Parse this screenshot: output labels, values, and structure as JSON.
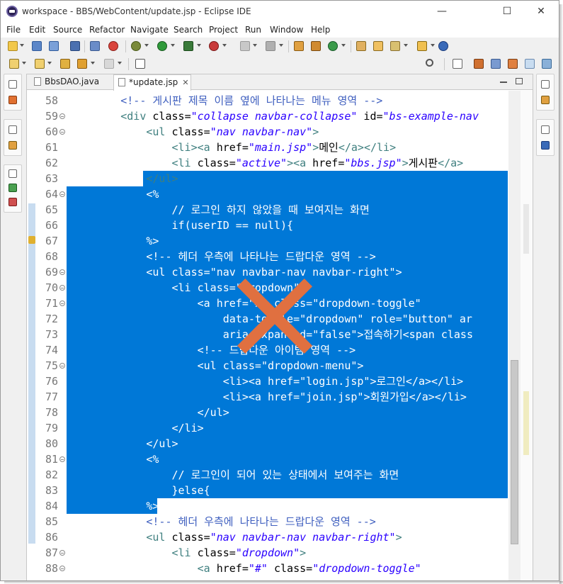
{
  "window": {
    "title": "workspace - BBS/WebContent/update.jsp - Eclipse IDE",
    "minimize": "—",
    "maximize": "☐",
    "close": "✕"
  },
  "menu": [
    "File",
    "Edit",
    "Source",
    "Refactor",
    "Navigate",
    "Search",
    "Project",
    "Run",
    "Window",
    "Help"
  ],
  "tabs": [
    {
      "label": "BbsDAO.java",
      "active": false
    },
    {
      "label": "*update.jsp",
      "active": true,
      "close": "✕"
    }
  ],
  "editor": {
    "selection_color": "#0078d7",
    "lines": [
      {
        "n": "58",
        "code": "        <!-- 게시판 제목 이름 옆에 나타나는 메뉴 영역 -->"
      },
      {
        "n": "59",
        "code": "        <div class=\"collapse navbar-collapse\" id=\"bs-example-nav"
      },
      {
        "n": "60",
        "code": "            <ul class=\"nav navbar-nav\">"
      },
      {
        "n": "61",
        "code": "                <li><a href=\"main.jsp\">메인</a></li>"
      },
      {
        "n": "62",
        "code": "                <li class=\"active\"><a href=\"bbs.jsp\">게시판</a><"
      },
      {
        "n": "63",
        "code": "            </ul>"
      },
      {
        "n": "64",
        "code": "            <%"
      },
      {
        "n": "65",
        "code": "                // 로그인 하지 않았을 때 보여지는 화면"
      },
      {
        "n": "66",
        "code": "                if(userID == null){"
      },
      {
        "n": "67",
        "code": "            %>"
      },
      {
        "n": "68",
        "code": "            <!-- 헤더 우측에 나타나는 드랍다운 영역 -->"
      },
      {
        "n": "69",
        "code": "            <ul class=\"nav navbar-nav navbar-right\">"
      },
      {
        "n": "70",
        "code": "                <li class=\"dropdown\">"
      },
      {
        "n": "71",
        "code": "                    <a href=\"#\" class=\"dropdown-toggle\""
      },
      {
        "n": "72",
        "code": "                        data-toggle=\"dropdown\" role=\"button\" ar"
      },
      {
        "n": "73",
        "code": "                        aria-expanded=\"false\">접속하기<span class"
      },
      {
        "n": "74",
        "code": "                    <!-- 드랍다운 아이템 영역 -->"
      },
      {
        "n": "75",
        "code": "                    <ul class=\"dropdown-menu\">"
      },
      {
        "n": "76",
        "code": "                        <li><a href=\"login.jsp\">로그인</a></li>"
      },
      {
        "n": "77",
        "code": "                        <li><a href=\"join.jsp\">회원가입</a></li>"
      },
      {
        "n": "78",
        "code": "                    </ul>"
      },
      {
        "n": "79",
        "code": "                </li>"
      },
      {
        "n": "80",
        "code": "            </ul>"
      },
      {
        "n": "81",
        "code": "            <%"
      },
      {
        "n": "82",
        "code": "                // 로그인이 되어 있는 상태에서 보여주는 화면"
      },
      {
        "n": "83",
        "code": "                }else{"
      },
      {
        "n": "84",
        "code": "            %>"
      },
      {
        "n": "85",
        "code": "            <!-- 헤더 우측에 나타나는 드랍다운 영역 -->"
      },
      {
        "n": "86",
        "code": "            <ul class=\"nav navbar-nav navbar-right\">"
      },
      {
        "n": "87",
        "code": "                <li class=\"dropdown\">"
      },
      {
        "n": "88",
        "code": "                    <a href=\"#\" class=\"dropdown-toggle\""
      }
    ]
  },
  "overlay": {
    "mark": "✕",
    "color": "#e07040"
  }
}
